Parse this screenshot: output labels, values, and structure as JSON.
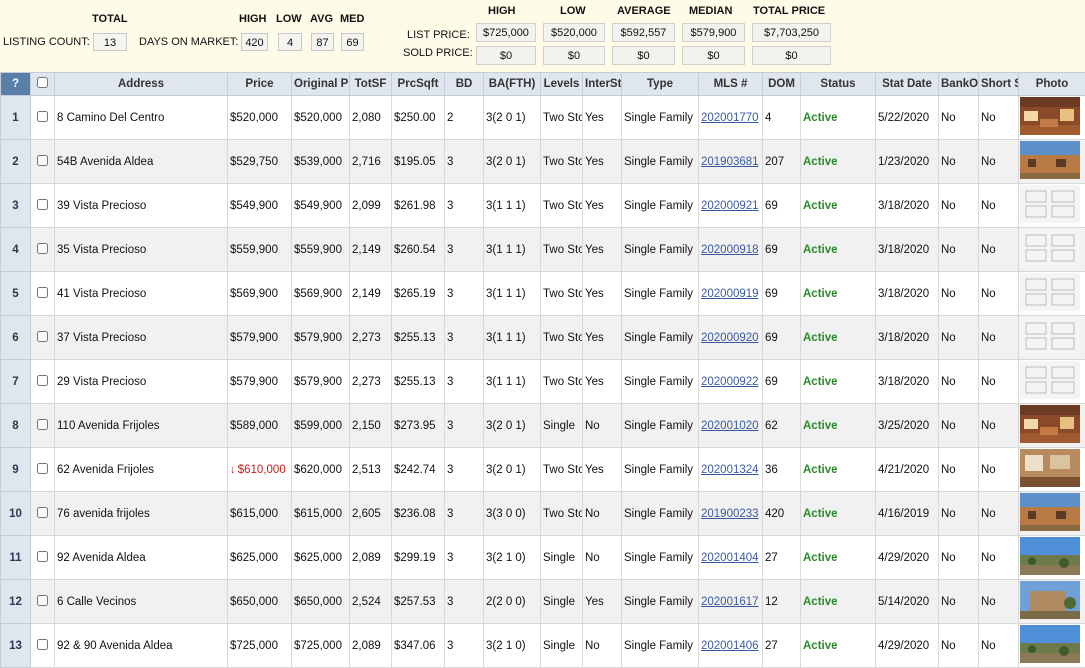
{
  "summary": {
    "total_label": "TOTAL",
    "listing_count_label": "LISTING COUNT:",
    "listing_count": "13",
    "days_on_market_label": "DAYS ON MARKET:",
    "dom_headers": {
      "high": "HIGH",
      "low": "LOW",
      "avg": "AVG",
      "med": "MED"
    },
    "dom_values": {
      "high": "420",
      "low": "4",
      "avg": "87",
      "med": "69"
    },
    "price_headers": {
      "high": "HIGH",
      "low": "LOW",
      "average": "AVERAGE",
      "median": "MEDIAN",
      "total": "TOTAL PRICE"
    },
    "list_price_label": "LIST PRICE:",
    "sold_price_label": "SOLD PRICE:",
    "list_price": {
      "high": "$725,000",
      "low": "$520,000",
      "average": "$592,557",
      "median": "$579,900",
      "total": "$7,703,250"
    },
    "sold_price": {
      "high": "$0",
      "low": "$0",
      "average": "$0",
      "median": "$0",
      "total": "$0"
    }
  },
  "columns": [
    "?",
    "",
    "Address",
    "Price",
    "Original Price",
    "TotSF",
    "PrcSqft",
    "BD",
    "BA(FTH)",
    "Levels",
    "InterSt",
    "Type",
    "MLS #",
    "DOM",
    "Status",
    "Stat Date",
    "BankO",
    "Short Sale",
    "Photo"
  ],
  "rows": [
    {
      "n": "1",
      "address": "8 Camino Del Centro",
      "price": "$520,000",
      "price_down": false,
      "orig": "$520,000",
      "totsf": "2,080",
      "prcsqft": "$250.00",
      "bd": "2",
      "ba": "3(2 0 1)",
      "levels": "Two Story",
      "inter": "Yes",
      "type": "Single Family",
      "mls": "202001770",
      "dom": "4",
      "status": "Active",
      "stat_date": "5/22/2020",
      "bank": "No",
      "short": "No",
      "photo": "interior"
    },
    {
      "n": "2",
      "address": "54B Avenida Aldea",
      "price": "$529,750",
      "price_down": false,
      "orig": "$539,000",
      "totsf": "2,716",
      "prcsqft": "$195.05",
      "bd": "3",
      "ba": "3(2 0 1)",
      "levels": "Two Story",
      "inter": "Yes",
      "type": "Single Family",
      "mls": "201903681",
      "dom": "207",
      "status": "Active",
      "stat_date": "1/23/2020",
      "bank": "No",
      "short": "No",
      "photo": "exterior"
    },
    {
      "n": "3",
      "address": "39 Vista Precioso",
      "price": "$549,900",
      "price_down": false,
      "orig": "$549,900",
      "totsf": "2,099",
      "prcsqft": "$261.98",
      "bd": "3",
      "ba": "3(1 1 1)",
      "levels": "Two Story",
      "inter": "Yes",
      "type": "Single Family",
      "mls": "202000921",
      "dom": "69",
      "status": "Active",
      "stat_date": "3/18/2020",
      "bank": "No",
      "short": "No",
      "photo": "plan"
    },
    {
      "n": "4",
      "address": "35 Vista Precioso",
      "price": "$559,900",
      "price_down": false,
      "orig": "$559,900",
      "totsf": "2,149",
      "prcsqft": "$260.54",
      "bd": "3",
      "ba": "3(1 1 1)",
      "levels": "Two Story",
      "inter": "Yes",
      "type": "Single Family",
      "mls": "202000918",
      "dom": "69",
      "status": "Active",
      "stat_date": "3/18/2020",
      "bank": "No",
      "short": "No",
      "photo": "plan"
    },
    {
      "n": "5",
      "address": "41 Vista Precioso",
      "price": "$569,900",
      "price_down": false,
      "orig": "$569,900",
      "totsf": "2,149",
      "prcsqft": "$265.19",
      "bd": "3",
      "ba": "3(1 1 1)",
      "levels": "Two Story",
      "inter": "Yes",
      "type": "Single Family",
      "mls": "202000919",
      "dom": "69",
      "status": "Active",
      "stat_date": "3/18/2020",
      "bank": "No",
      "short": "No",
      "photo": "plan"
    },
    {
      "n": "6",
      "address": "37 Vista Precioso",
      "price": "$579,900",
      "price_down": false,
      "orig": "$579,900",
      "totsf": "2,273",
      "prcsqft": "$255.13",
      "bd": "3",
      "ba": "3(1 1 1)",
      "levels": "Two Story",
      "inter": "Yes",
      "type": "Single Family",
      "mls": "202000920",
      "dom": "69",
      "status": "Active",
      "stat_date": "3/18/2020",
      "bank": "No",
      "short": "No",
      "photo": "plan"
    },
    {
      "n": "7",
      "address": "29 Vista Precioso",
      "price": "$579,900",
      "price_down": false,
      "orig": "$579,900",
      "totsf": "2,273",
      "prcsqft": "$255.13",
      "bd": "3",
      "ba": "3(1 1 1)",
      "levels": "Two Story",
      "inter": "Yes",
      "type": "Single Family",
      "mls": "202000922",
      "dom": "69",
      "status": "Active",
      "stat_date": "3/18/2020",
      "bank": "No",
      "short": "No",
      "photo": "plan"
    },
    {
      "n": "8",
      "address": "110 Avenida Frijoles",
      "price": "$589,000",
      "price_down": false,
      "orig": "$599,000",
      "totsf": "2,150",
      "prcsqft": "$273.95",
      "bd": "3",
      "ba": "3(2 0 1)",
      "levels": "Single",
      "inter": "No",
      "type": "Single Family",
      "mls": "202001020",
      "dom": "62",
      "status": "Active",
      "stat_date": "3/25/2020",
      "bank": "No",
      "short": "No",
      "photo": "interior"
    },
    {
      "n": "9",
      "address": "62 Avenida Frijoles",
      "price": "$610,000",
      "price_down": true,
      "orig": "$620,000",
      "totsf": "2,513",
      "prcsqft": "$242.74",
      "bd": "3",
      "ba": "3(2 0 1)",
      "levels": "Two Story",
      "inter": "Yes",
      "type": "Single Family",
      "mls": "202001324",
      "dom": "36",
      "status": "Active",
      "stat_date": "4/21/2020",
      "bank": "No",
      "short": "No",
      "photo": "interior2"
    },
    {
      "n": "10",
      "address": "76 avenida frijoles",
      "price": "$615,000",
      "price_down": false,
      "orig": "$615,000",
      "totsf": "2,605",
      "prcsqft": "$236.08",
      "bd": "3",
      "ba": "3(3 0 0)",
      "levels": "Two Story",
      "inter": "No",
      "type": "Single Family",
      "mls": "201900233",
      "dom": "420",
      "status": "Active",
      "stat_date": "4/16/2019",
      "bank": "No",
      "short": "No",
      "photo": "exterior"
    },
    {
      "n": "11",
      "address": "92 Avenida Aldea",
      "price": "$625,000",
      "price_down": false,
      "orig": "$625,000",
      "totsf": "2,089",
      "prcsqft": "$299.19",
      "bd": "3",
      "ba": "3(2 1 0)",
      "levels": "Single",
      "inter": "No",
      "type": "Single Family",
      "mls": "202001404",
      "dom": "27",
      "status": "Active",
      "stat_date": "4/29/2020",
      "bank": "No",
      "short": "No",
      "photo": "landscape"
    },
    {
      "n": "12",
      "address": "6 Calle Vecinos",
      "price": "$650,000",
      "price_down": false,
      "orig": "$650,000",
      "totsf": "2,524",
      "prcsqft": "$257.53",
      "bd": "3",
      "ba": "2(2 0 0)",
      "levels": "Single",
      "inter": "Yes",
      "type": "Single Family",
      "mls": "202001617",
      "dom": "12",
      "status": "Active",
      "stat_date": "5/14/2020",
      "bank": "No",
      "short": "No",
      "photo": "landscape2"
    },
    {
      "n": "13",
      "address": "92 & 90 Avenida Aldea",
      "price": "$725,000",
      "price_down": false,
      "orig": "$725,000",
      "totsf": "2,089",
      "prcsqft": "$347.06",
      "bd": "3",
      "ba": "3(2 1 0)",
      "levels": "Single",
      "inter": "No",
      "type": "Single Family",
      "mls": "202001406",
      "dom": "27",
      "status": "Active",
      "stat_date": "4/29/2020",
      "bank": "No",
      "short": "No",
      "photo": "landscape"
    }
  ]
}
